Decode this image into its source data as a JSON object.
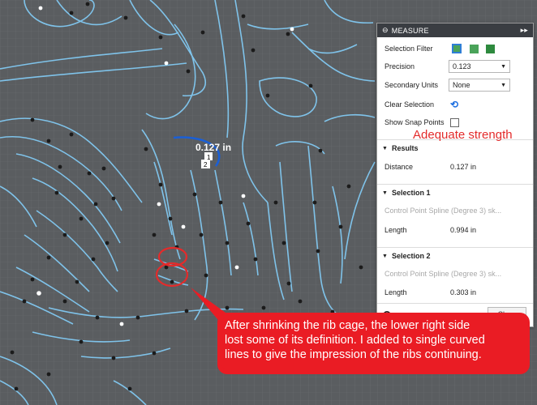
{
  "panel": {
    "title": "MEASURE",
    "collapse_icon": "▸▸",
    "selection_filter_label": "Selection Filter",
    "precision_label": "Precision",
    "precision_value": "0.123",
    "secondary_units_label": "Secondary Units",
    "secondary_units_value": "None",
    "clear_selection_label": "Clear Selection",
    "show_snap_points_label": "Show Snap Points",
    "results": {
      "header": "Results",
      "distance_label": "Distance",
      "distance_value": "0.127 in"
    },
    "selection1": {
      "header": "Selection 1",
      "object": "Control Point Spline (Degree 3) sk...",
      "length_label": "Length",
      "length_value": "0.994 in"
    },
    "selection2": {
      "header": "Selection 2",
      "object": "Control Point Spline (Degree 3) sk...",
      "length_label": "Length",
      "length_value": "0.303 in"
    },
    "close_label": "Close",
    "info_icon": "i"
  },
  "canvas": {
    "measure_tag": "0.127 in",
    "point1": "1",
    "point2": "2"
  },
  "annotations": {
    "adequate": "Adequate strength",
    "callout_lines": [
      "After shrinking the rib cage, the lower right side",
      "lost some of its definition. I added to single curved",
      "lines to give the impression of the ribs continuing."
    ]
  },
  "colors": {
    "canvas_bg": "#5a5d60",
    "grid": "#6b6e71",
    "spline": "#7fc3ea",
    "accent_blue": "#1a5fd6",
    "annotation_red": "#e32b2b"
  }
}
